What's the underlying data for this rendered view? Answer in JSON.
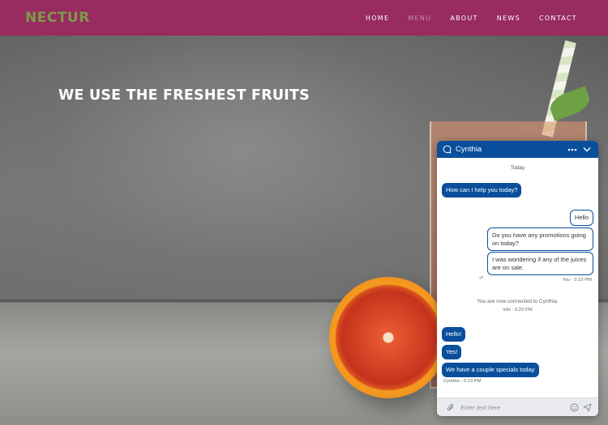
{
  "nav": {
    "logo": "NECTUR",
    "logo_color": "#7e9a4a",
    "bar_color": "#982b5f",
    "links": [
      {
        "label": "HOME"
      },
      {
        "label": "MENU",
        "active": true
      },
      {
        "label": "ABOUT"
      },
      {
        "label": "NEWS"
      },
      {
        "label": "CONTACT"
      }
    ]
  },
  "hero": {
    "heading": "WE USE THE FRESHEST FRUITS"
  },
  "chat": {
    "title": "Cynthia",
    "accent": "#0a4f9c",
    "date_label": "Today",
    "messages": {
      "m1": "How can I help you today?",
      "m2": "Hello",
      "m3": "Do you have any promotions going on today?",
      "m4": "I was wondering if any of the juices are on sale.",
      "user_meta": "You - 5:22 PM",
      "system": "You are now connected to Cynthia.",
      "system_meta": "Info - 5:22 PM",
      "m5": "Hello!",
      "m6": "Yes!",
      "m7": "We have a couple specials today",
      "agent_meta": "Cynthia - 5:23 PM"
    },
    "input_placeholder": "Enter text here",
    "icons": {
      "header": "chat-bubble-icon",
      "more": "more-options-icon",
      "minimize": "chevron-down-icon",
      "attach": "paperclip-icon",
      "emoji": "emoji-icon",
      "send": "send-icon",
      "read": "read-receipt-icon"
    }
  }
}
